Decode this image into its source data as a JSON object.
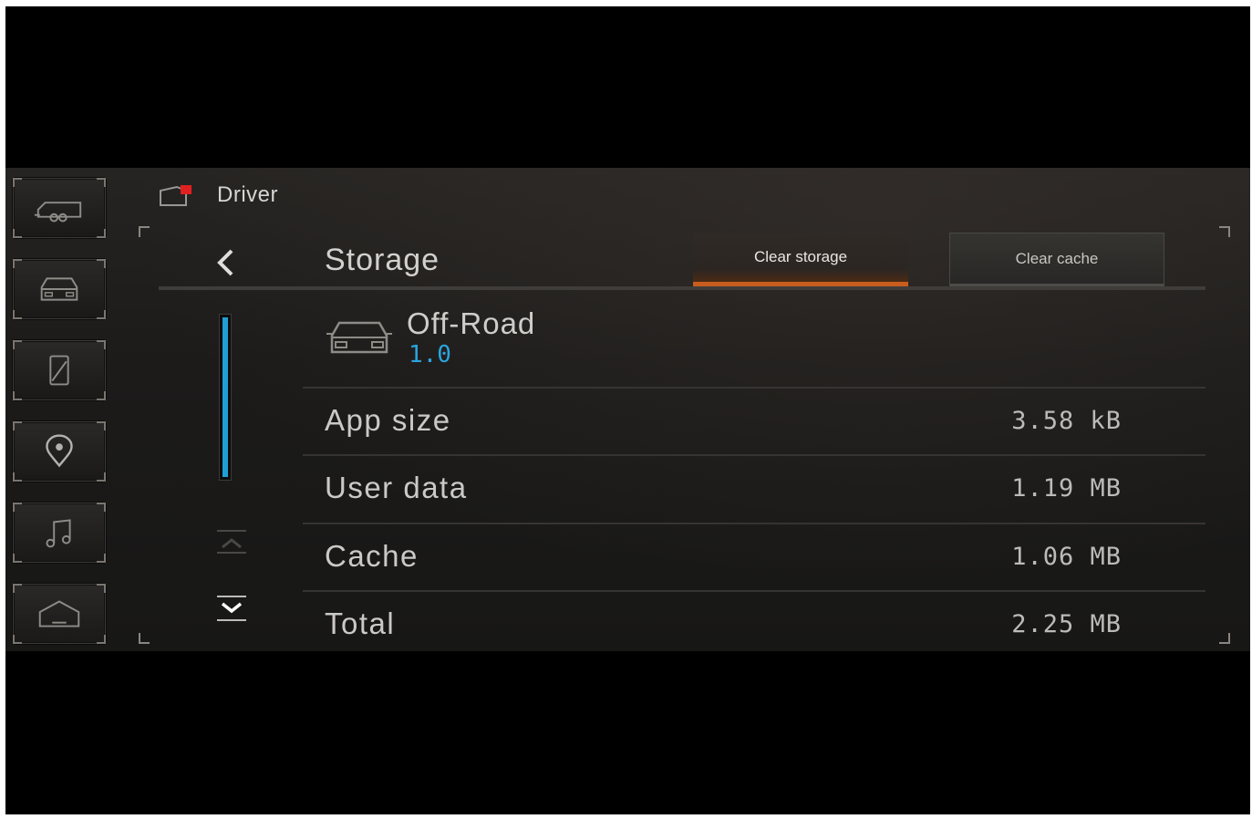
{
  "header": {
    "title": "Driver"
  },
  "rail": {
    "items": [
      {
        "icon": "trailer-icon"
      },
      {
        "icon": "vehicle-icon"
      },
      {
        "icon": "phone-icon"
      },
      {
        "icon": "location-pin-icon"
      },
      {
        "icon": "music-note-icon"
      },
      {
        "icon": "home-icon"
      }
    ]
  },
  "page": {
    "title": "Storage",
    "back_icon": "chevron-left-icon",
    "clear_storage_label": "Clear storage",
    "clear_cache_label": "Clear cache"
  },
  "app": {
    "name": "Off-Road",
    "version": "1.0",
    "icon": "vehicle-icon"
  },
  "rows": [
    {
      "label": "App size",
      "value": "3.58 kB"
    },
    {
      "label": "User data",
      "value": "1.19 MB"
    },
    {
      "label": "Cache",
      "value": "1.06 MB"
    },
    {
      "label": "Total",
      "value": "2.25 MB"
    }
  ],
  "colors": {
    "accent_orange": "#c85d1f",
    "accent_blue": "#1f9fd6",
    "alert_red": "#e02020"
  }
}
